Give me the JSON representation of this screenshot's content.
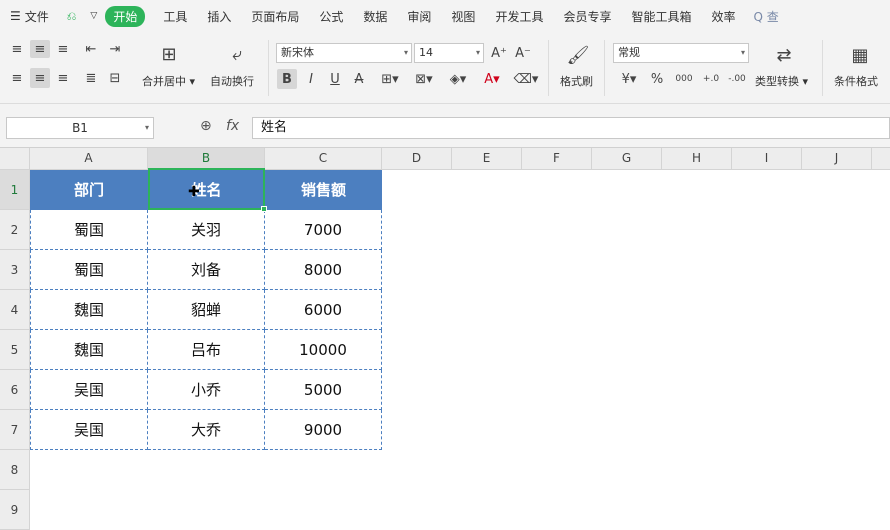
{
  "menu": {
    "file": "文件",
    "tabs": [
      "开始",
      "工具",
      "插入",
      "页面布局",
      "公式",
      "数据",
      "审阅",
      "视图",
      "开发工具",
      "会员专享",
      "智能工具箱",
      "效率"
    ],
    "search": "Q 查"
  },
  "ribbon": {
    "merge_label": "合并居中",
    "wrap_label": "自动换行",
    "font_name": "新宋体",
    "font_size": "14",
    "bold": "B",
    "italic": "I",
    "underline": "U",
    "format_painter": "格式刷",
    "number_format": "常规",
    "type_convert": "类型转换",
    "cond_format": "条件格式",
    "currency_symbol": "¥",
    "percent_symbol": "%",
    "thousands_symbol": "000",
    "inc_decimal": "+.0",
    "dec_decimal": "-.00"
  },
  "formula_bar": {
    "name_box": "B1",
    "fx": "fx",
    "content": "姓名"
  },
  "columns": [
    "A",
    "B",
    "C",
    "D",
    "E",
    "F",
    "G",
    "H",
    "I",
    "J"
  ],
  "rows": [
    "1",
    "2",
    "3",
    "4",
    "5",
    "6",
    "7",
    "8",
    "9"
  ],
  "table": {
    "headers": [
      "部门",
      "姓名",
      "销售额"
    ],
    "data": [
      [
        "蜀国",
        "关羽",
        "7000"
      ],
      [
        "蜀国",
        "刘备",
        "8000"
      ],
      [
        "魏国",
        "貂蝉",
        "6000"
      ],
      [
        "魏国",
        "吕布",
        "10000"
      ],
      [
        "吴国",
        "小乔",
        "5000"
      ],
      [
        "吴国",
        "大乔",
        "9000"
      ]
    ]
  },
  "colors": {
    "accent": "#2db45a",
    "header_fill": "#4c7fc0",
    "border": "#4c7fc0"
  }
}
